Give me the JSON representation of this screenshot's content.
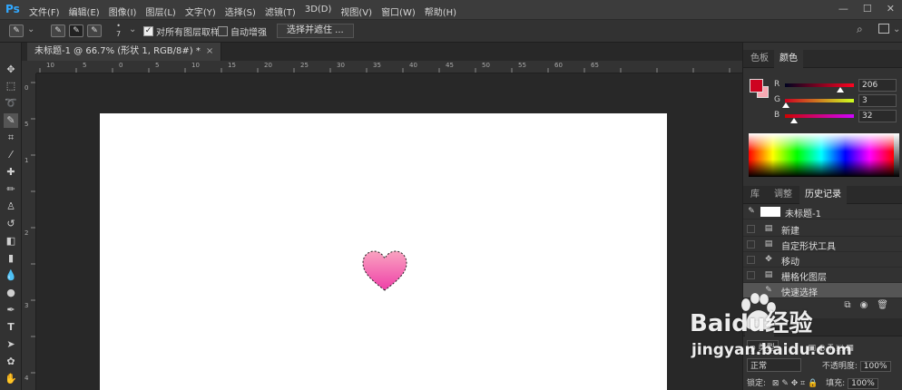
{
  "app": {
    "logo": "Ps"
  },
  "menu": [
    "文件(F)",
    "编辑(E)",
    "图像(I)",
    "图层(L)",
    "文字(Y)",
    "选择(S)",
    "滤镜(T)",
    "3D(D)",
    "视图(V)",
    "窗口(W)",
    "帮助(H)"
  ],
  "window_controls": [
    "—",
    "☐",
    "✕"
  ],
  "options_bar": {
    "brush_size": "7",
    "sample_all_layers_label": "对所有图层取样",
    "sample_all_layers_checked": true,
    "auto_enhance_label": "自动增强",
    "auto_enhance_checked": false,
    "select_and_mask_label": "选择并遮住 ..."
  },
  "document_tab": {
    "title": "未标题-1 @ 66.7% (形状 1, RGB/8#) *",
    "close": "×"
  },
  "rulers": {
    "top": [
      "10",
      "5",
      "0",
      "5",
      "10",
      "15",
      "20",
      "25",
      "30",
      "35",
      "40",
      "45",
      "50",
      "55",
      "60",
      "65"
    ],
    "left": [
      "0",
      "5",
      "1",
      "2",
      "3",
      "4"
    ]
  },
  "color_panel": {
    "tabs": [
      "色板",
      "颜色"
    ],
    "active_tab": "颜色",
    "foreground": "#ce0320",
    "background": "#f6a9b3",
    "r_label": "R",
    "r_value": "206",
    "r_level": 206,
    "g_label": "G",
    "g_value": "3",
    "g_level": 3,
    "b_label": "B",
    "b_value": "32",
    "b_level": 32
  },
  "history_panel": {
    "tabs": [
      "库",
      "调整",
      "历史记录"
    ],
    "active_tab": "历史记录",
    "snapshot_label": "未标题-1",
    "items": [
      {
        "label": "新建",
        "icon": "document-icon"
      },
      {
        "label": "自定形状工具",
        "icon": "document-icon"
      },
      {
        "label": "移动",
        "icon": "move-icon"
      },
      {
        "label": "栅格化图层",
        "icon": "document-icon"
      },
      {
        "label": "快速选择",
        "icon": "quick-select-icon",
        "active": true
      }
    ]
  },
  "layers_panel": {
    "tab": "图层",
    "kind_label": "ρ 类型",
    "blend_mode": "正常",
    "opacity_label": "不透明度:",
    "opacity_value": "100%",
    "lock_label": "锁定:",
    "fill_label": "填充:",
    "fill_value": "100%"
  },
  "watermark": {
    "brand": "Baidu经验",
    "url": "jingyan.baidu.com"
  }
}
